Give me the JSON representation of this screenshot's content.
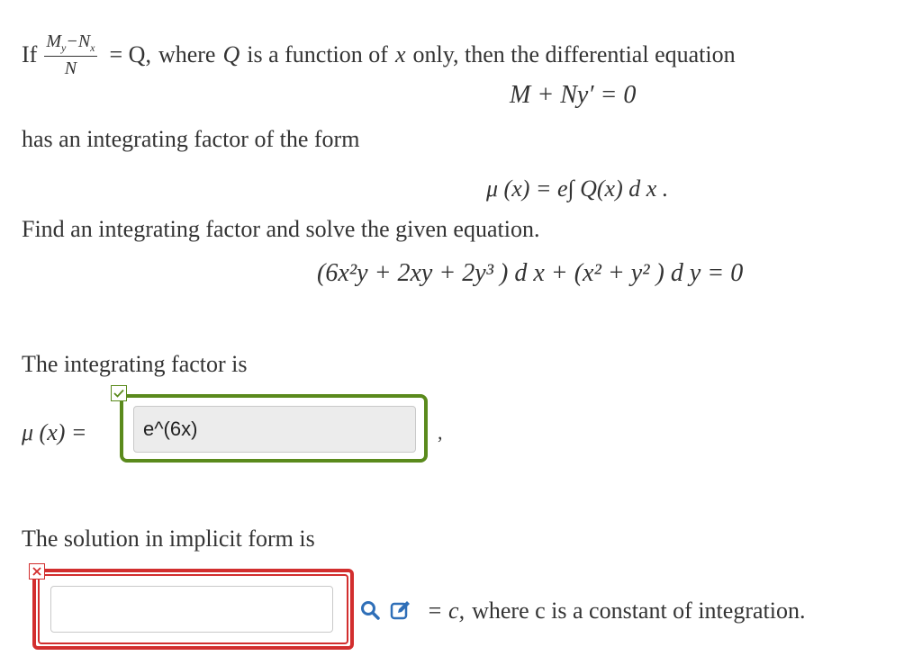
{
  "problem": {
    "if_word": "If",
    "frac_num": "My−Nx",
    "frac_num_M": "M",
    "frac_num_y": "y",
    "frac_num_minus": "−",
    "frac_num_N": "N",
    "frac_num_x": "x",
    "frac_den": "N",
    "line1_eq": "= Q,",
    "line1_rest1": "where",
    "line1_Q": "Q",
    "line1_rest2": "is a function of",
    "line1_x": "x",
    "line1_rest3": "only, then the differential equation",
    "eq_center": "M + Ny′ = 0",
    "line2": "has an integrating factor of the form",
    "formula": "μ (x) = e∫ Q(x) d x .",
    "line3": "Find an integrating factor and solve the given equation.",
    "given_eq": "(6x²y + 2xy + 2y³ ) d x + (x² + y² ) d y = 0"
  },
  "part1": {
    "label": "The integrating factor is",
    "mu_label": "μ (x) =",
    "answer_value": "e^(6x)",
    "comma": ",",
    "status": "correct"
  },
  "part2": {
    "label": "The solution in implicit form is",
    "answer_value": "",
    "suffix_eq": "= c,",
    "suffix_text": "where c is a constant of integration.",
    "status": "incorrect"
  },
  "colors": {
    "correct": "#5a8a1c",
    "incorrect": "#d22e2e",
    "tool_blue": "#2f6fb8"
  },
  "icons": {
    "preview": "magnifier-icon",
    "editor": "pencil-square-icon"
  }
}
